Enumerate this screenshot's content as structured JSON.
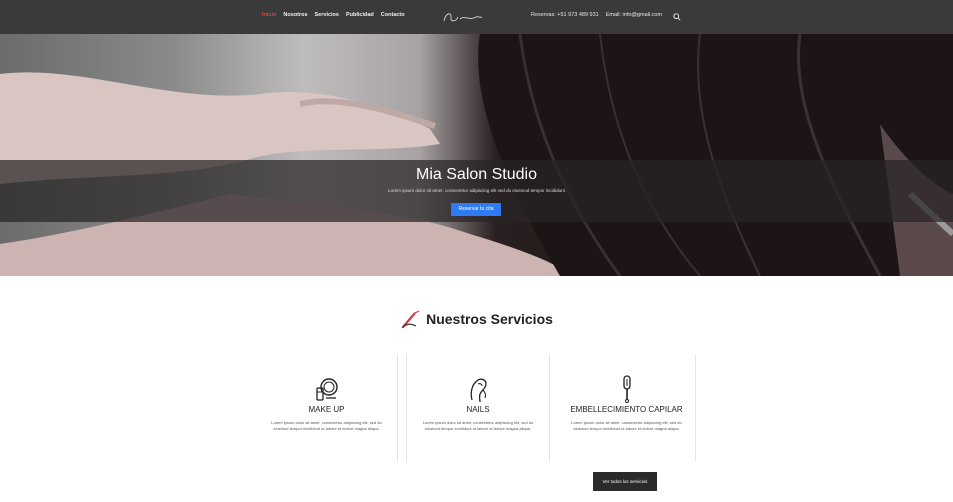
{
  "nav": {
    "links": [
      {
        "label": "Inicio",
        "active": true
      },
      {
        "label": "Nosotros",
        "active": false
      },
      {
        "label": "Servicios",
        "active": false
      },
      {
        "label": "Publicidad",
        "active": false
      },
      {
        "label": "Contacto",
        "active": false
      }
    ],
    "contact": {
      "phone": "Reservas: +51 973 489 931",
      "email": "Email: info@gmail.com"
    }
  },
  "hero": {
    "title": "Mia Salon Studio",
    "subtitle": "Lorem ipsum dolor sit amet, consectetur adipiscing elit sed do eiusmod tempor incididunt",
    "button_label": "Reservar tu cita"
  },
  "services_section": {
    "heading": "Nuestros Servicios",
    "items": [
      {
        "title": "MAKE UP",
        "icon": "makeup-mirror-icon",
        "description": "Lorem ipsum dolor sit amet, consectetur adipiscing elit, sed do eiusmod tempor incididunt ut labore et dolore magna aliqua."
      },
      {
        "title": "NAILS",
        "icon": "nail-polish-hand-icon",
        "description": "Lorem ipsum dolor sit amet, consectetur adipiscing elit, sed do eiusmod tempor incididunt ut labore et dolore magna aliqua."
      },
      {
        "title": "EMBELLECIMIENTO CAPILAR",
        "icon": "hair-dryer-icon",
        "description": "Lorem ipsum dolor sit amet, consectetur adipiscing elit, sed do eiusmod tempor incididunt ut labore et dolore magna aliqua."
      }
    ],
    "view_more_label": "Ver todos los servicios"
  },
  "colors": {
    "navbar": "#3a3a3a",
    "nav_active": "#e0453a",
    "hero_button": "#2f7bf5",
    "dark_button": "#2b2b2b"
  }
}
